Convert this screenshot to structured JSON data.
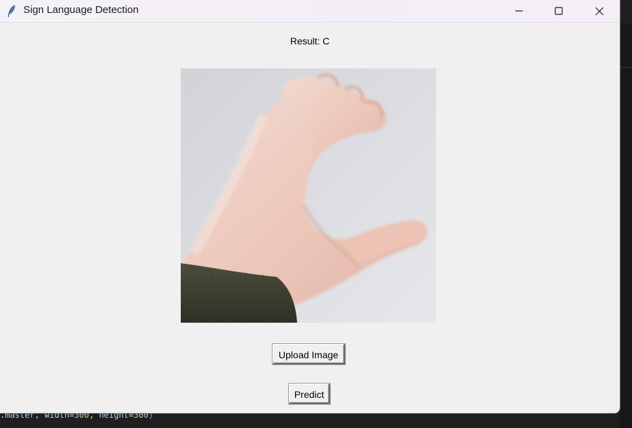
{
  "window": {
    "title": "Sign Language Detection",
    "app_icon": "feather-icon",
    "controls": [
      "minimize-icon",
      "maximize-icon",
      "close-icon"
    ]
  },
  "result": {
    "text": "Result: C"
  },
  "image": {
    "description_icon": "uploaded-hand-sign-image"
  },
  "buttons": {
    "upload_label": "Upload Image",
    "predict_label": "Predict"
  },
  "background_code": {
    "prefix": ".master, ",
    "width_key": "width",
    "eq1": "=",
    "width_val": "300",
    "sep": ", ",
    "height_key": "height",
    "eq2": "=",
    "height_val": "300",
    "close": ")"
  },
  "colors": {
    "window_bg": "#f0f0f0",
    "titlebar_bg": "#f4f0f6",
    "desktop_bg": "#1f1f1f"
  }
}
